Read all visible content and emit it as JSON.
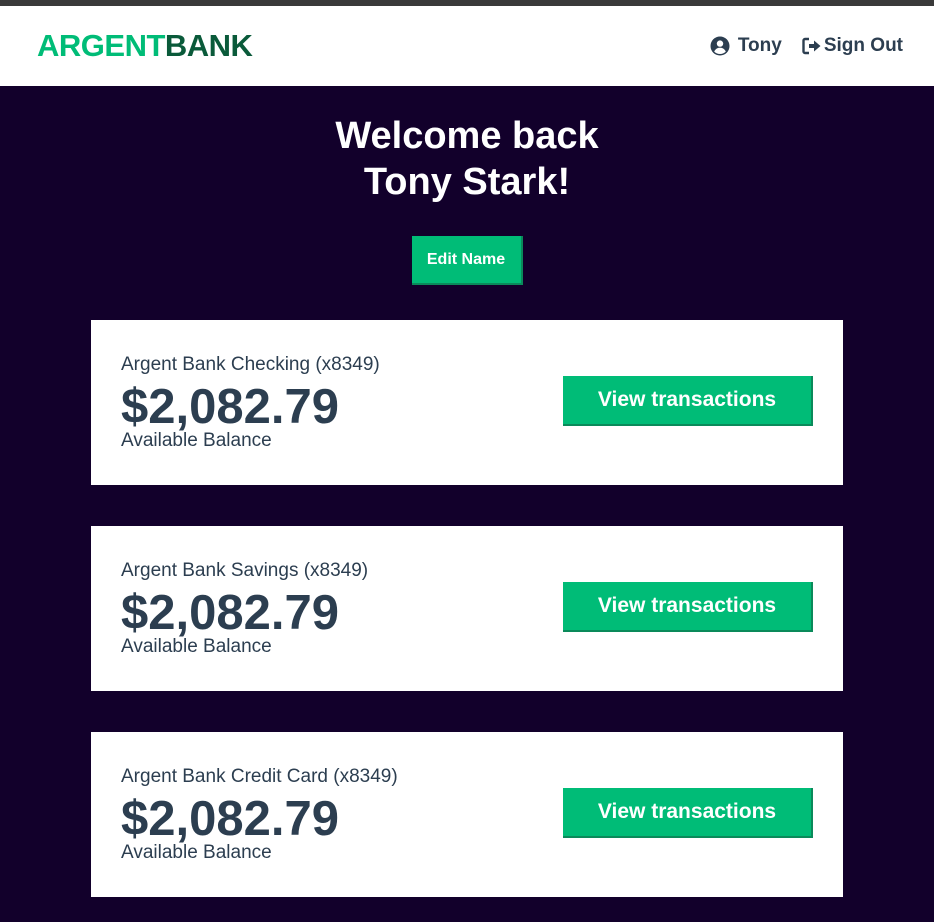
{
  "header": {
    "logo_part1": "ARGENT",
    "logo_part2": "BANK",
    "user_name": "Tony",
    "user_icon": "user-circle-icon",
    "signout_icon": "sign-out-icon",
    "signout_label": "Sign Out"
  },
  "hero": {
    "line1": "Welcome back",
    "line2": "Tony Stark!",
    "edit_label": "Edit Name"
  },
  "accounts": [
    {
      "title": "Argent Bank Checking (x8349)",
      "amount": "$2,082.79",
      "description": "Available Balance",
      "button": "View transactions"
    },
    {
      "title": "Argent Bank Savings (x8349)",
      "amount": "$2,082.79",
      "description": "Available Balance",
      "button": "View transactions"
    },
    {
      "title": "Argent Bank Credit Card (x8349)",
      "amount": "$2,082.79",
      "description": "Available Balance",
      "button": "View transactions"
    }
  ],
  "colors": {
    "accent": "#00bc77",
    "background": "#12002b",
    "text": "#2c3e50"
  }
}
